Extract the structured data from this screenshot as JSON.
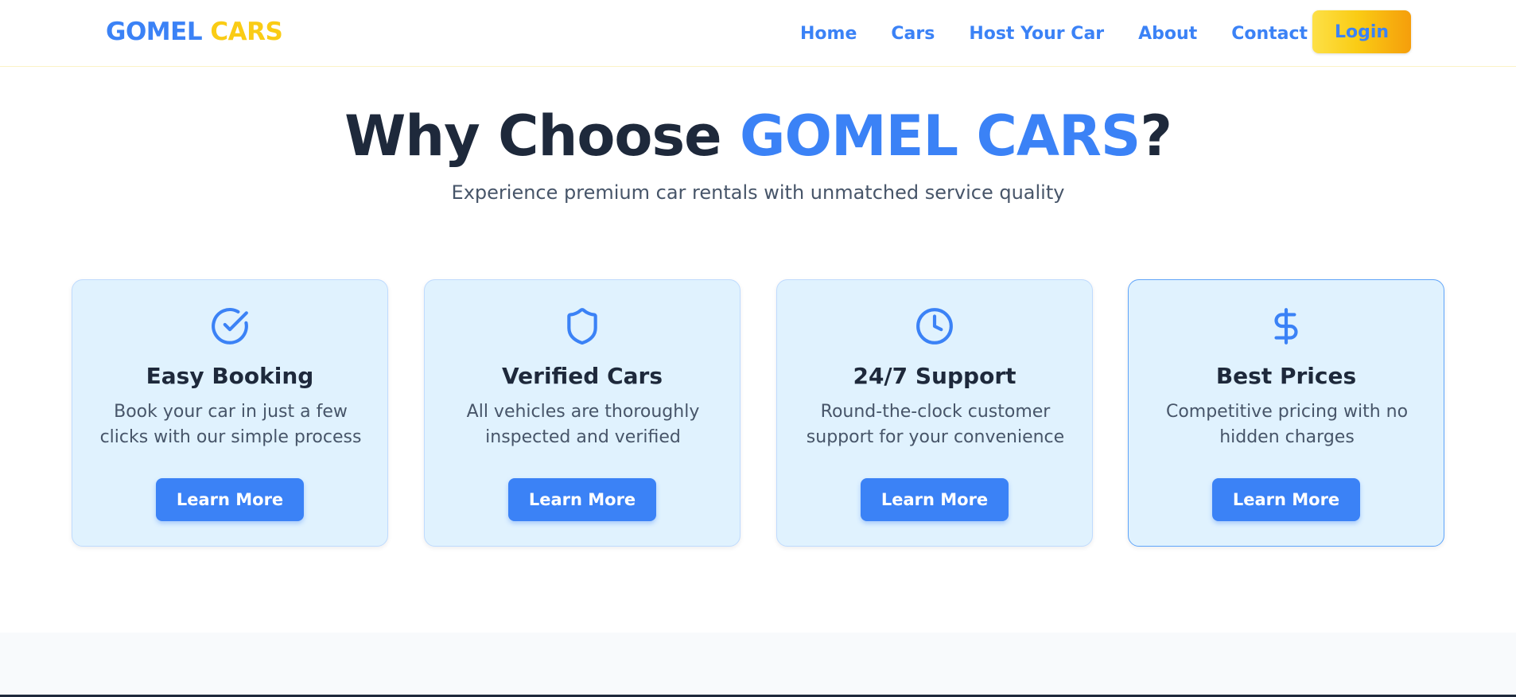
{
  "brand": {
    "part1": "GOMEL",
    "part2": "CARS"
  },
  "nav": {
    "links": [
      "Home",
      "Cars",
      "Host Your Car",
      "About",
      "Contact"
    ],
    "login_label": "Login"
  },
  "hero": {
    "title_prefix": "Why Choose ",
    "title_accent": "GOMEL CARS",
    "title_suffix": "?",
    "subtitle": "Experience premium car rentals with unmatched service quality"
  },
  "features": [
    {
      "icon": "check-circle-icon",
      "title": "Easy Booking",
      "description": "Book your car in just a few clicks with our simple process",
      "button": "Learn More"
    },
    {
      "icon": "shield-icon",
      "title": "Verified Cars",
      "description": "All vehicles are thoroughly inspected and verified",
      "button": "Learn More"
    },
    {
      "icon": "clock-icon",
      "title": "24/7 Support",
      "description": "Round-the-clock customer support for your convenience",
      "button": "Learn More"
    },
    {
      "icon": "dollar-icon",
      "title": "Best Prices",
      "description": "Competitive pricing with no hidden charges",
      "button": "Learn More"
    }
  ],
  "colors": {
    "primary": "#3b82f6",
    "accent_yellow": "#facc15",
    "heading": "#1e293b",
    "card_bg": "#e0f2fe"
  }
}
